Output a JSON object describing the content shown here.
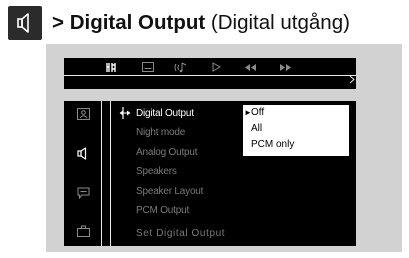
{
  "title": {
    "prefix": ">",
    "main": "Digital Output",
    "subtitle": "(Digital utgång)",
    "icon": "speaker-icon"
  },
  "topbar": {
    "active_tab_icon": "settings-tab-icon",
    "icons": [
      "settings-tab-icon",
      "subtitle-icon",
      "audio-icon",
      "play-icon",
      "rewind-icon",
      "fast-forward-icon"
    ]
  },
  "sidebar": {
    "icons": [
      "general-setup-icon",
      "audio-setup-icon",
      "preference-icon",
      "parental-icon"
    ],
    "active_index": 1
  },
  "menu": {
    "items": [
      "Digital Output",
      "Night mode",
      "Analog Output",
      "Speakers",
      "Speaker Layout",
      "PCM Output"
    ],
    "active_index": 0,
    "status": "Set Digital Output"
  },
  "dropdown": {
    "options": [
      "Off",
      "All",
      "PCM only"
    ],
    "selected_index": 0
  },
  "colors": {
    "osd_background": "#d2d2d2",
    "panel": "#000000",
    "inactive_text": "#7a7a7a",
    "active_text": "#ffffff"
  }
}
